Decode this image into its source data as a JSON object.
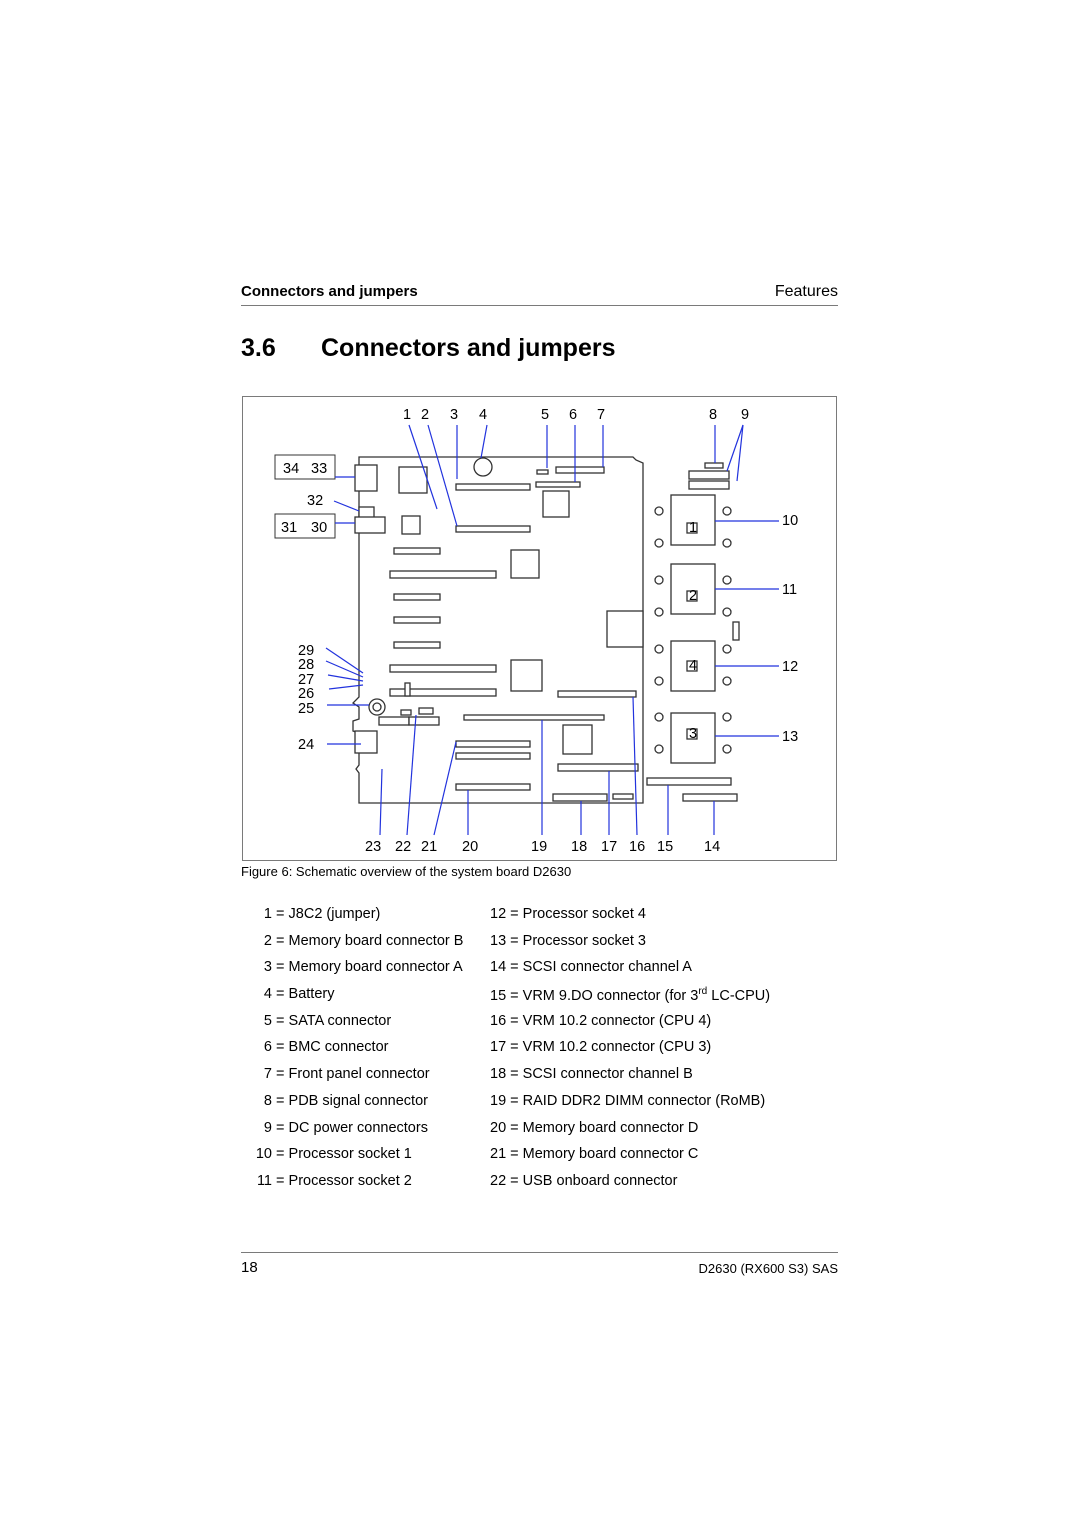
{
  "header": {
    "left": "Connectors and jumpers",
    "right": "Features"
  },
  "section": {
    "number": "3.6",
    "title": "Connectors and jumpers"
  },
  "figure": {
    "caption": "Figure 6: Schematic overview of the system board D2630",
    "top_callouts": [
      "1",
      "2",
      "3",
      "4",
      "5",
      "6",
      "7",
      "8",
      "9"
    ],
    "right_callouts": [
      "10",
      "11",
      "12",
      "13"
    ],
    "bottom_callouts": [
      "23",
      "22",
      "21",
      "20",
      "19",
      "18",
      "17",
      "16",
      "15",
      "14"
    ],
    "left_callouts": {
      "box1": [
        "34",
        "33"
      ],
      "single32": "32",
      "box2": [
        "31",
        "30"
      ],
      "stack": [
        "29",
        "28",
        "27",
        "26",
        "25"
      ],
      "single24": "24"
    },
    "socket_labels": [
      "1",
      "2",
      "4",
      "3"
    ]
  },
  "legend": {
    "col1": [
      {
        "key": "1",
        "text": "= J8C2 (jumper)"
      },
      {
        "key": "2",
        "text": "= Memory board connector B"
      },
      {
        "key": "3",
        "text": "= Memory board connector A"
      },
      {
        "key": "4",
        "text": "= Battery"
      },
      {
        "key": "5",
        "text": "= SATA connector"
      },
      {
        "key": "6",
        "text": "= BMC connector"
      },
      {
        "key": "7",
        "text": "= Front panel connector"
      },
      {
        "key": "8",
        "text": "= PDB signal connector"
      },
      {
        "key": "9",
        "text": "= DC power connectors"
      },
      {
        "key": "10",
        "text": "= Processor socket 1"
      },
      {
        "key": "11",
        "text": "= Processor socket 2"
      }
    ],
    "col2": [
      {
        "key": "12",
        "text": "= Processor socket 4"
      },
      {
        "key": "13",
        "text": "= Processor socket 3"
      },
      {
        "key": "14",
        "text": "= SCSI connector channel A"
      },
      {
        "key": "15",
        "text": "= VRM 9.DO connector (for 3",
        "sup": "rd",
        "after": " LC-CPU)"
      },
      {
        "key": "16",
        "text": "= VRM 10.2 connector (CPU 4)"
      },
      {
        "key": "17",
        "text": "= VRM 10.2 connector (CPU 3)"
      },
      {
        "key": "18",
        "text": "= SCSI connector channel B"
      },
      {
        "key": "19",
        "text": "= RAID DDR2 DIMM connector (RoMB)"
      },
      {
        "key": "20",
        "text": "= Memory board connector D"
      },
      {
        "key": "21",
        "text": "= Memory board connector C"
      },
      {
        "key": "22",
        "text": "= USB onboard connector"
      }
    ]
  },
  "footer": {
    "page_number": "18",
    "doc_title": "D2630 (RX600 S3) SAS"
  }
}
